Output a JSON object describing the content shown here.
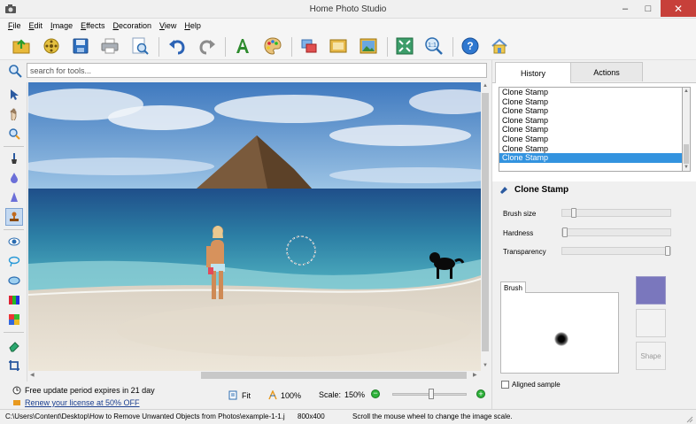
{
  "window": {
    "title": "Home Photo Studio",
    "minimize": "–",
    "maximize": "□",
    "close": "✕"
  },
  "menu": [
    {
      "underline": "F",
      "rest": "ile"
    },
    {
      "underline": "E",
      "rest": "dit"
    },
    {
      "underline": "I",
      "rest": "mage"
    },
    {
      "underline": "E",
      "rest": "ffects"
    },
    {
      "underline": "D",
      "rest": "ecoration"
    },
    {
      "underline": "V",
      "rest": "iew"
    },
    {
      "underline": "H",
      "rest": "elp"
    }
  ],
  "search": {
    "placeholder": "search for tools..."
  },
  "history": {
    "tab_history": "History",
    "tab_actions": "Actions",
    "items": [
      "Clone Stamp",
      "Clone Stamp",
      "Clone Stamp",
      "Clone Stamp",
      "Clone Stamp",
      "Clone Stamp",
      "Clone Stamp",
      "Clone Stamp"
    ],
    "selected_index": 7
  },
  "tool": {
    "name": "Clone Stamp",
    "brush_size_label": "Brush size",
    "hardness_label": "Hardness",
    "transparency_label": "Transparency",
    "brush_tab": "Brush",
    "shape_label": "Shape",
    "aligned_label": "Aligned sample",
    "color": "#7a77bd"
  },
  "bottom": {
    "update_text": "Free update period expires in 21 day",
    "renew_link": "Renew your license at 50% OFF",
    "fit_label": "Fit",
    "zoom_100": "100%",
    "scale_label": "Scale:",
    "scale_value": "150%"
  },
  "status": {
    "path": "C:\\Users\\Content\\Desktop\\How to Remove Unwanted Objects from Photos\\example-1-1.j",
    "dimensions": "800x400",
    "hint": "Scroll the mouse wheel to change the image scale."
  }
}
